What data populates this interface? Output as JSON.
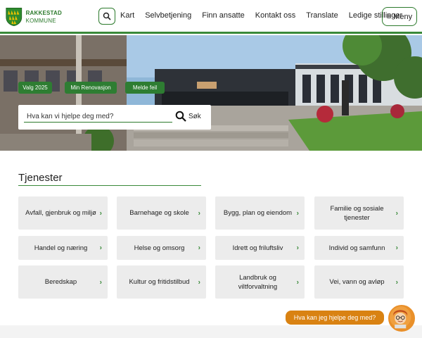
{
  "logo": {
    "line1": "RAKKESTAD",
    "line2": "KOMMUNE"
  },
  "header": {
    "nav": [
      "Kart",
      "Selvbetjening",
      "Finn ansatte",
      "Kontakt oss",
      "Translate",
      "Ledige stillinger"
    ],
    "menu_label": "Meny",
    "menu_icon": "≡"
  },
  "hero": {
    "quick_links": [
      "Valg 2025",
      "Min Renovasjon",
      "Melde feil"
    ],
    "search_placeholder": "Hva kan vi hjelpe deg med?",
    "search_button": "Søk"
  },
  "services": {
    "title": "Tjenester",
    "items": [
      "Avfall, gjenbruk og miljø",
      "Barnehage og skole",
      "Bygg, plan og eiendom",
      "Familie og sosiale tjenester",
      "Handel og næring",
      "Helse og omsorg",
      "Idrett og friluftsliv",
      "Individ og samfunn",
      "Beredskap",
      "Kultur og fritidstilbud",
      "Landbruk og viltforvaltning",
      "Vei, vann og avløp"
    ]
  },
  "chat": {
    "label": "Hva kan jeg hjelpe deg med?"
  },
  "colors": {
    "brand_green": "#2c7a2c",
    "quick_link_bg": "#2e7d32",
    "card_bg": "#ececec",
    "chat_orange": "#d98212"
  },
  "icons": {
    "search": "search-icon",
    "menu": "hamburger-icon",
    "chevron": "chevron-right-icon"
  }
}
